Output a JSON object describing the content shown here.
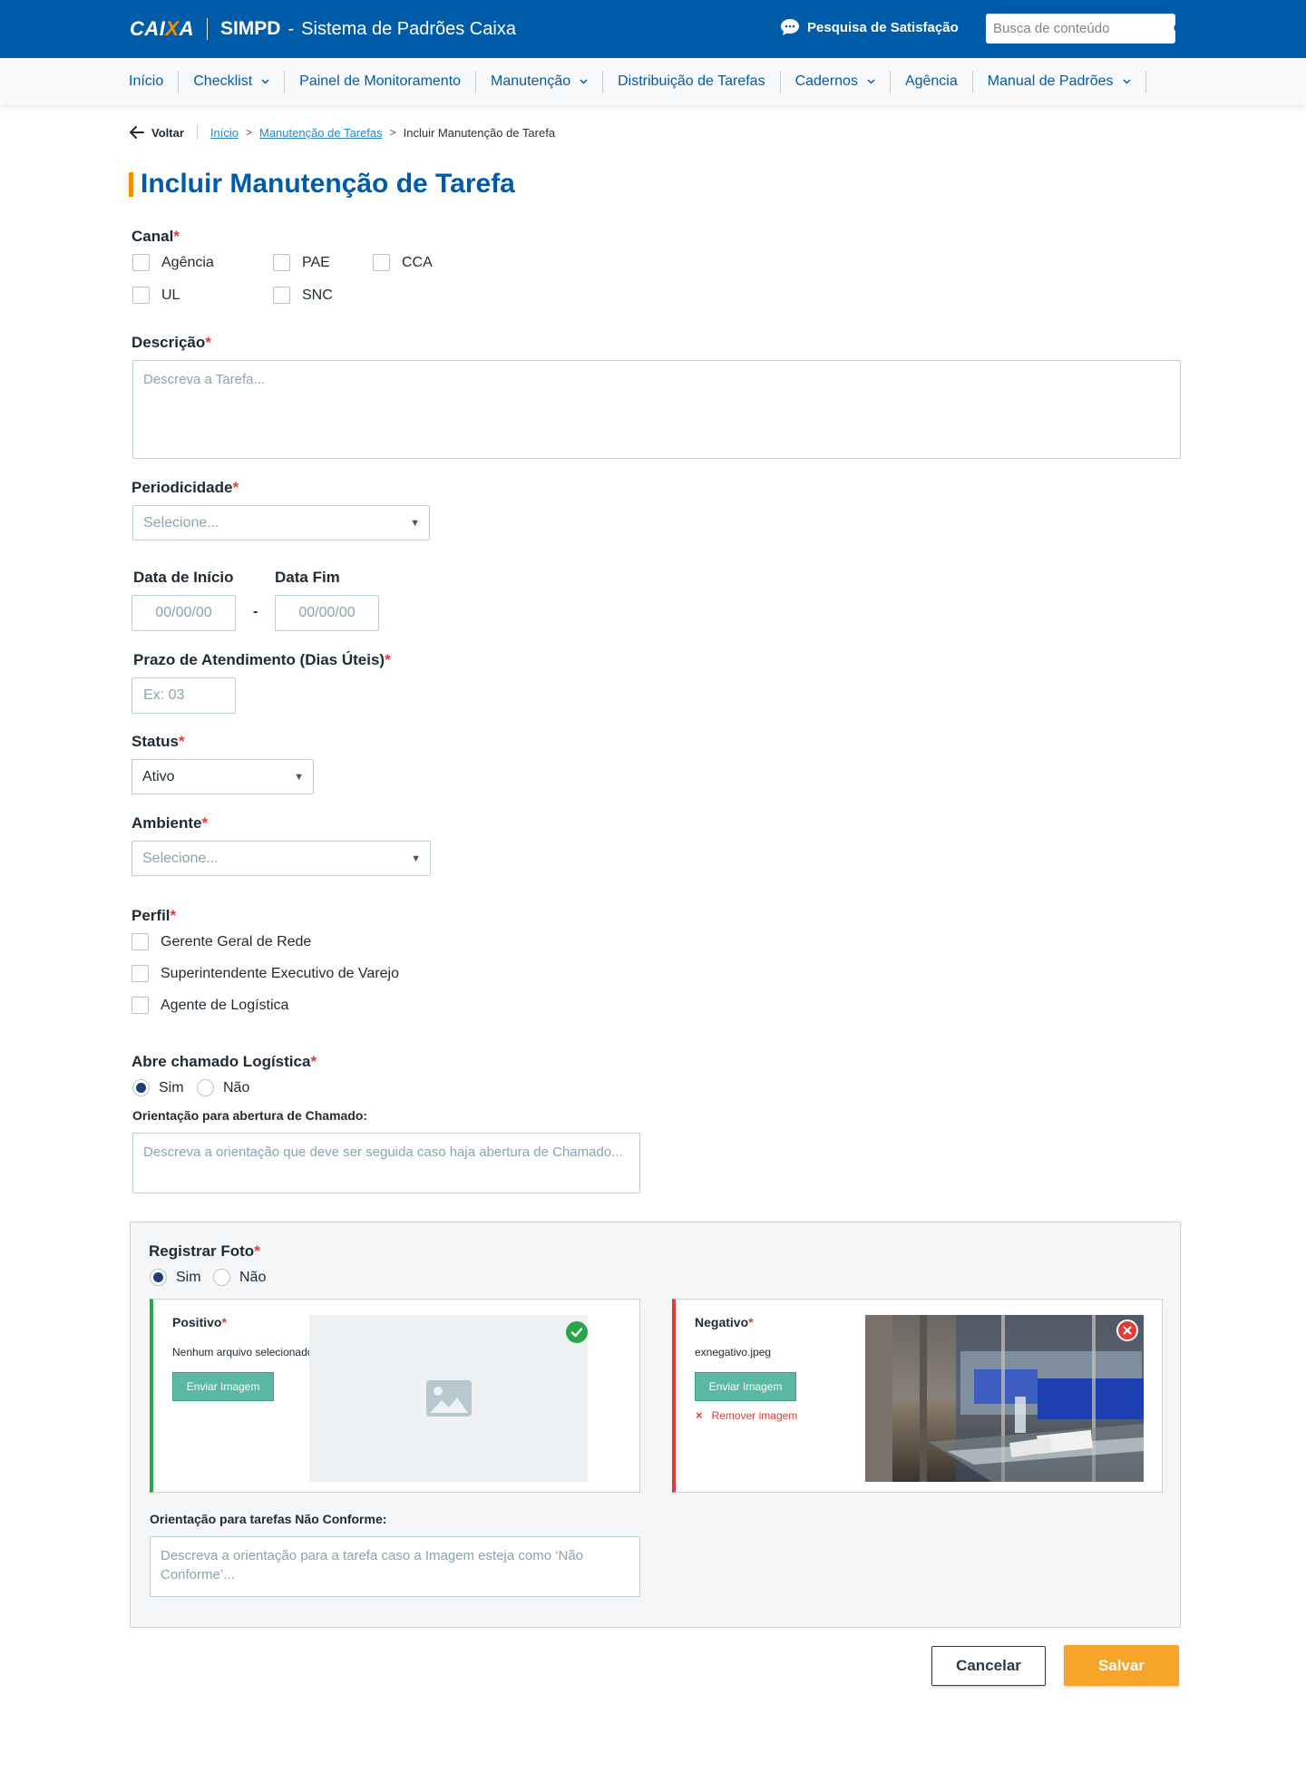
{
  "header": {
    "logo": {
      "pre": "CAI",
      "x": "X",
      "post": "A"
    },
    "app_name": "SIMPD",
    "dash": "-",
    "app_subtitle": "Sistema de Padrões Caixa",
    "survey_label": "Pesquisa de Satisfação",
    "search_placeholder": "Busca de conteúdo",
    "colors": {
      "primary": "#005ca9",
      "accent": "#f39200"
    }
  },
  "nav": {
    "items": [
      {
        "label": "Início"
      },
      {
        "label": "Checklist"
      },
      {
        "label": "Painel de Monitoramento"
      },
      {
        "label": "Manutenção"
      },
      {
        "label": "Distribuição de Tarefas"
      },
      {
        "label": "Cadernos"
      },
      {
        "label": "Agência"
      },
      {
        "label": "Manual de Padrões"
      }
    ]
  },
  "breadcrumb": {
    "back_label": "Voltar",
    "links": [
      "Início",
      "Manutenção de Tarefas"
    ],
    "chevron": ">",
    "current": "Incluir Manutenção de Tarefa"
  },
  "page_title": "Incluir Manutenção de Tarefa",
  "required_mark": "*",
  "form": {
    "canal": {
      "label": "Canal",
      "options": [
        "Agência",
        "PAE",
        "CCA",
        "UL",
        "SNC"
      ]
    },
    "descricao": {
      "label": "Descrição",
      "placeholder": "Descreva a Tarefa..."
    },
    "periodicidade": {
      "label": "Periodicidade",
      "placeholder": "Selecione..."
    },
    "data_inicio": {
      "label": "Data de Início",
      "placeholder": "00/00/00"
    },
    "date_sep": "-",
    "data_fim": {
      "label": "Data Fim",
      "placeholder": "00/00/00"
    },
    "prazo": {
      "label": "Prazo de Atendimento (Dias Úteis)",
      "placeholder": "Ex: 03"
    },
    "status": {
      "label": "Status",
      "value": "Ativo"
    },
    "ambiente": {
      "label": "Ambiente",
      "placeholder": "Selecione..."
    },
    "perfil": {
      "label": "Perfil",
      "options": [
        "Gerente Geral de Rede",
        "Superintendente Executivo de Varejo",
        "Agente de Logística"
      ]
    },
    "chamado": {
      "label": "Abre chamado Logística",
      "options": [
        "Sim",
        "Não"
      ],
      "selected": "Sim",
      "orient_label": "Orientação para abertura de Chamado:",
      "orient_placeholder": "Descreva a orientação que deve ser seguida caso haja abertura de Chamado..."
    },
    "foto": {
      "label": "Registrar Foto",
      "options": [
        "Sim",
        "Não"
      ],
      "selected": "Sim",
      "positivo": {
        "title": "Positivo",
        "file": "Nenhum arquivo selecionado.",
        "button": "Enviar Imagem",
        "status_color": "#2aa549"
      },
      "negativo": {
        "title": "Negativo",
        "file": "exnegativo.jpeg",
        "button": "Enviar Imagem",
        "remove_icon": "×",
        "remove_label": "Remover imagem",
        "status_color": "#e53935"
      },
      "orient_label": "Orientação para tarefas Não Conforme:",
      "orient_placeholder": "Descreva a orientação para a tarefa caso a Imagem esteja como ‘Não Conforme’..."
    }
  },
  "actions": {
    "cancel": "Cancelar",
    "save": "Salvar"
  }
}
